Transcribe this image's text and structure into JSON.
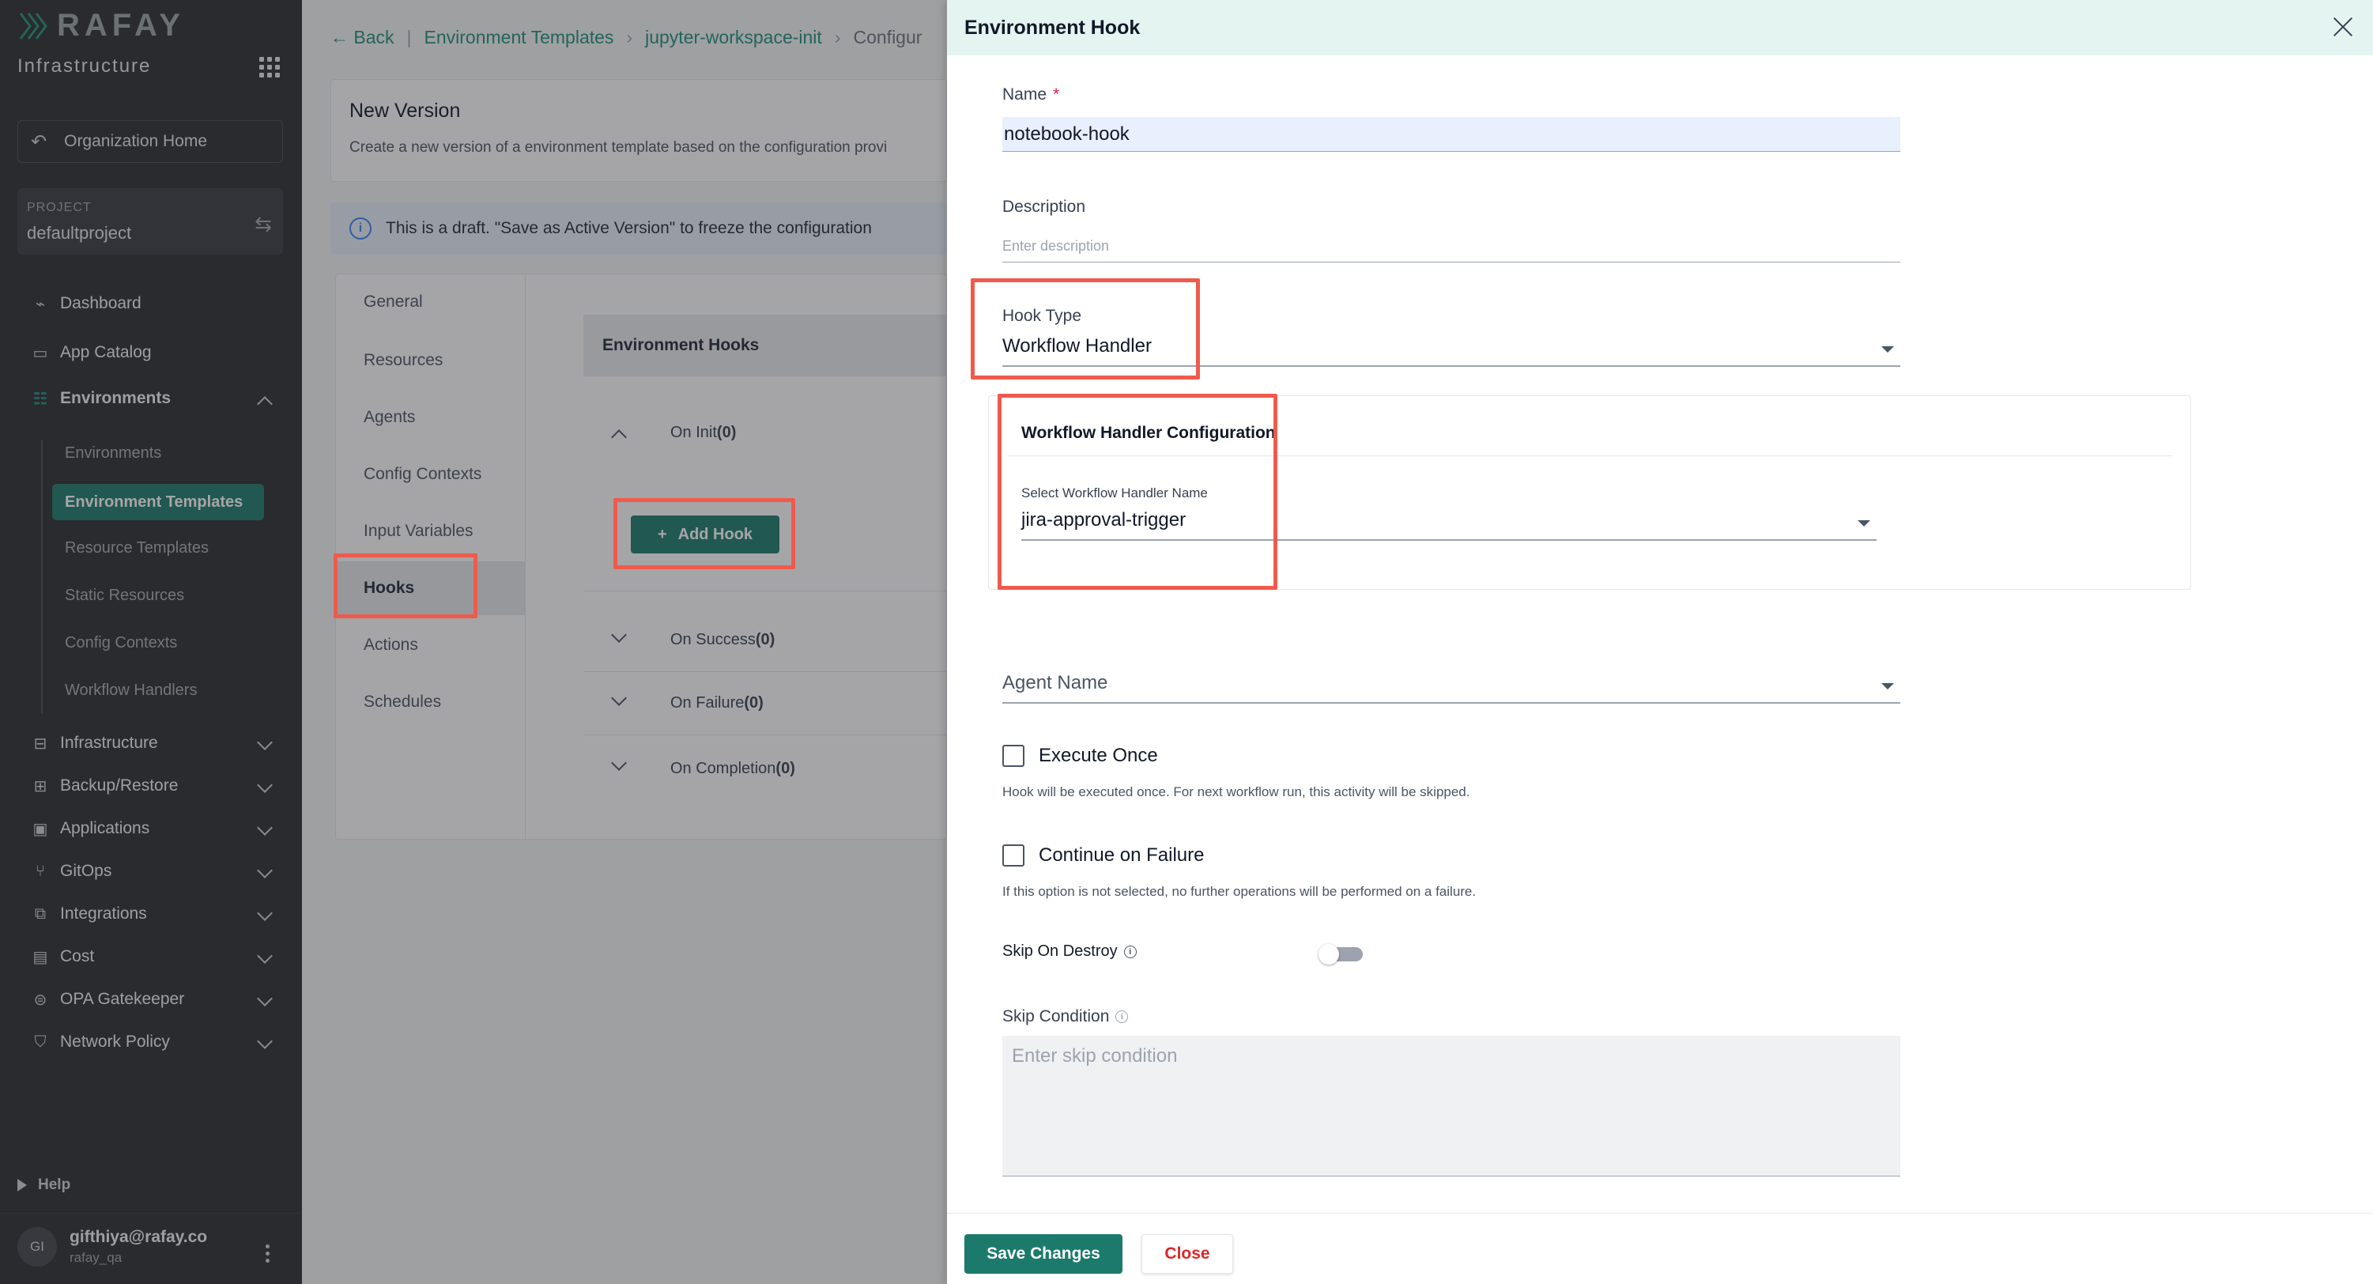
{
  "sidebar": {
    "logo": "RAFAY",
    "subtitle": "Infrastructure",
    "org_home": "Organization Home",
    "project_label": "PROJECT",
    "project_name": "defaultproject",
    "nav": {
      "dashboard": "Dashboard",
      "app_catalog": "App Catalog",
      "environments": "Environments",
      "infrastructure": "Infrastructure",
      "backup_restore": "Backup/Restore",
      "applications": "Applications",
      "gitops": "GitOps",
      "integrations": "Integrations",
      "cost": "Cost",
      "opa_gatekeeper": "OPA Gatekeeper",
      "network_policy": "Network Policy"
    },
    "env_sub": {
      "environments": "Environments",
      "environment_templates": "Environment Templates",
      "resource_templates": "Resource Templates",
      "static_resources": "Static Resources",
      "config_contexts": "Config Contexts",
      "workflow_handlers": "Workflow Handlers"
    },
    "help": "Help",
    "user_initials": "GI",
    "user_email": "gifthiya@rafay.co",
    "user_org": "rafay_qa"
  },
  "main": {
    "breadcrumb": {
      "back": "Back",
      "templates": "Environment Templates",
      "template_name": "jupyter-workspace-init",
      "current": "Configur"
    },
    "new_version": {
      "title": "New Version",
      "description": "Create a new version of a environment template based on the configuration provi"
    },
    "draft_notice": "This is a draft. \"Save as Active Version\" to freeze the configuration",
    "menu": {
      "general": "General",
      "resources": "Resources",
      "agents": "Agents",
      "config_contexts": "Config Contexts",
      "input_variables": "Input Variables",
      "hooks": "Hooks",
      "actions": "Actions",
      "schedules": "Schedules"
    },
    "hooks": {
      "header": "Environment Hooks",
      "on_init": "On Init",
      "on_init_count": "(0)",
      "add_hook": "Add Hook",
      "on_success": "On Success",
      "on_success_count": "(0)",
      "on_failure": "On Failure",
      "on_failure_count": "(0)",
      "on_completion": "On Completion",
      "on_completion_count": "(0)"
    }
  },
  "drawer": {
    "title": "Environment Hook",
    "name_label": "Name",
    "name_required": "*",
    "name_value": "notebook-hook",
    "description_label": "Description",
    "description_placeholder": "Enter description",
    "hook_type_label": "Hook Type",
    "hook_type_value": "Workflow Handler",
    "wf_config_title": "Workflow Handler Configuration",
    "wf_select_label": "Select Workflow Handler Name",
    "wf_select_value": "jira-approval-trigger",
    "agent_name_label": "Agent Name",
    "execute_once_label": "Execute Once",
    "execute_once_help": "Hook will be executed once. For next workflow run, this activity will be skipped.",
    "continue_on_failure_label": "Continue on Failure",
    "continue_on_failure_help": "If this option is not selected, no further operations will be performed on a failure.",
    "skip_on_destroy_label": "Skip On Destroy",
    "skip_condition_label": "Skip Condition",
    "skip_condition_placeholder": "Enter skip condition",
    "save_button": "Save Changes",
    "close_button": "Close"
  },
  "colors": {
    "accent": "#1c7a6c",
    "highlight": "#ef5a4c",
    "sidebar_bg": "#2c2d30",
    "drawer_header": "#e4f4f1"
  }
}
